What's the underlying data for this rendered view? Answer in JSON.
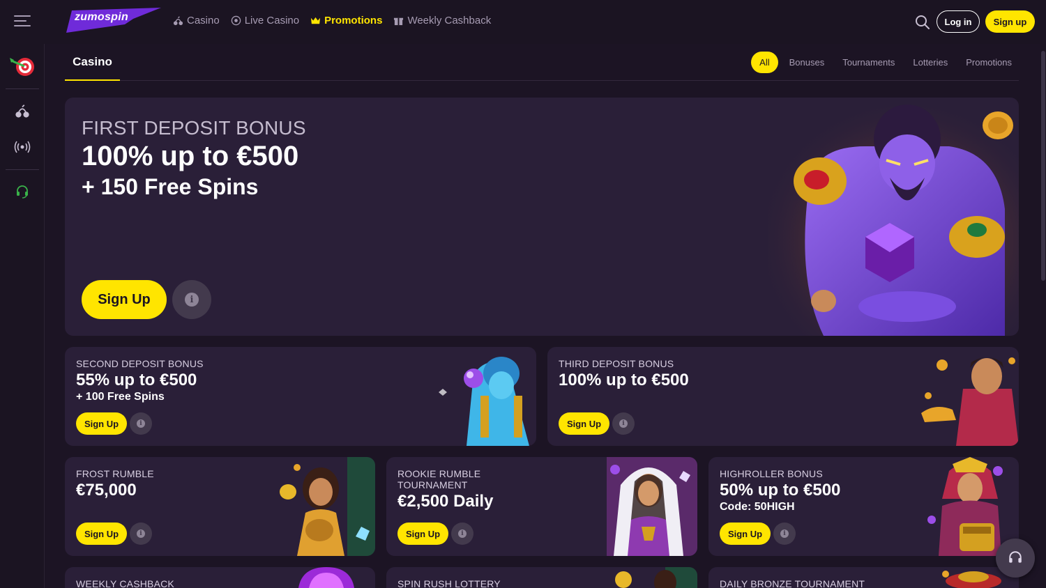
{
  "header": {
    "logo": "zumospin",
    "nav": [
      {
        "label": "Casino",
        "icon": "cherry-icon"
      },
      {
        "label": "Live Casino",
        "icon": "live-icon"
      },
      {
        "label": "Promotions",
        "icon": "crown-icon",
        "active": true
      },
      {
        "label": "Weekly Cashback",
        "icon": "gift-icon"
      }
    ],
    "login_label": "Log in",
    "signup_label": "Sign up"
  },
  "sidebar": {
    "items": [
      "target-icon",
      "cherry-icon",
      "live-signal-icon",
      "headset-icon"
    ]
  },
  "tabs": {
    "active": "Casino",
    "filters": [
      "All",
      "Bonuses",
      "Tournaments",
      "Lotteries",
      "Promotions"
    ]
  },
  "hero": {
    "category": "FIRST DEPOSIT BONUS",
    "title": "100% up to €500",
    "subtitle": "+ 150 Free Spins",
    "cta": "Sign Up"
  },
  "cards": [
    {
      "category": "SECOND DEPOSIT BONUS",
      "title": "55% up to €500",
      "subtitle": "+ 100 Free Spins",
      "cta": "Sign Up"
    },
    {
      "category": "THIRD DEPOSIT BONUS",
      "title": "100% up to €500",
      "subtitle": "",
      "cta": "Sign Up"
    },
    {
      "category": "FROST RUMBLE",
      "title": "€75,000",
      "subtitle": "",
      "cta": "Sign Up"
    },
    {
      "category": "ROOKIE RUMBLE TOURNAMENT",
      "title": "€2,500 Daily",
      "subtitle": "",
      "cta": "Sign Up"
    },
    {
      "category": "HIGHROLLER BONUS",
      "title": "50% up to €500",
      "subtitle": "Code: 50HIGH",
      "cta": "Sign Up"
    },
    {
      "category": "WEEKLY CASHBACK",
      "title": "",
      "subtitle": "",
      "cta": ""
    },
    {
      "category": "SPIN RUSH LOTTERY",
      "title": "",
      "subtitle": "",
      "cta": ""
    },
    {
      "category": "DAILY BRONZE TOURNAMENT",
      "title": "",
      "subtitle": "",
      "cta": ""
    }
  ],
  "colors": {
    "accent": "#ffe500",
    "background": "#1c1424",
    "card": "#2a1f38"
  }
}
